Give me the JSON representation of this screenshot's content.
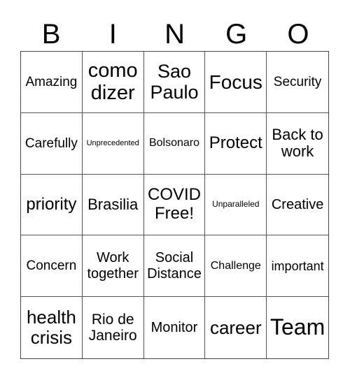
{
  "header": {
    "letters": [
      "B",
      "I",
      "N",
      "G",
      "O"
    ]
  },
  "cells": [
    [
      "Amazing",
      "como dizer",
      "Sao Paulo",
      "Focus",
      "Security"
    ],
    [
      "Carefully",
      "Unprecedented",
      "Bolsonaro",
      "Protect",
      "Back to work"
    ],
    [
      "priority",
      "Brasilia",
      "COVID Free!",
      "Unparalleled",
      "Creative"
    ],
    [
      "Concern",
      "Work together",
      "Social Distance",
      "Challenge",
      "important"
    ],
    [
      "health crisis",
      "Rio de Janeiro",
      "Monitor",
      "career",
      "Team"
    ]
  ]
}
